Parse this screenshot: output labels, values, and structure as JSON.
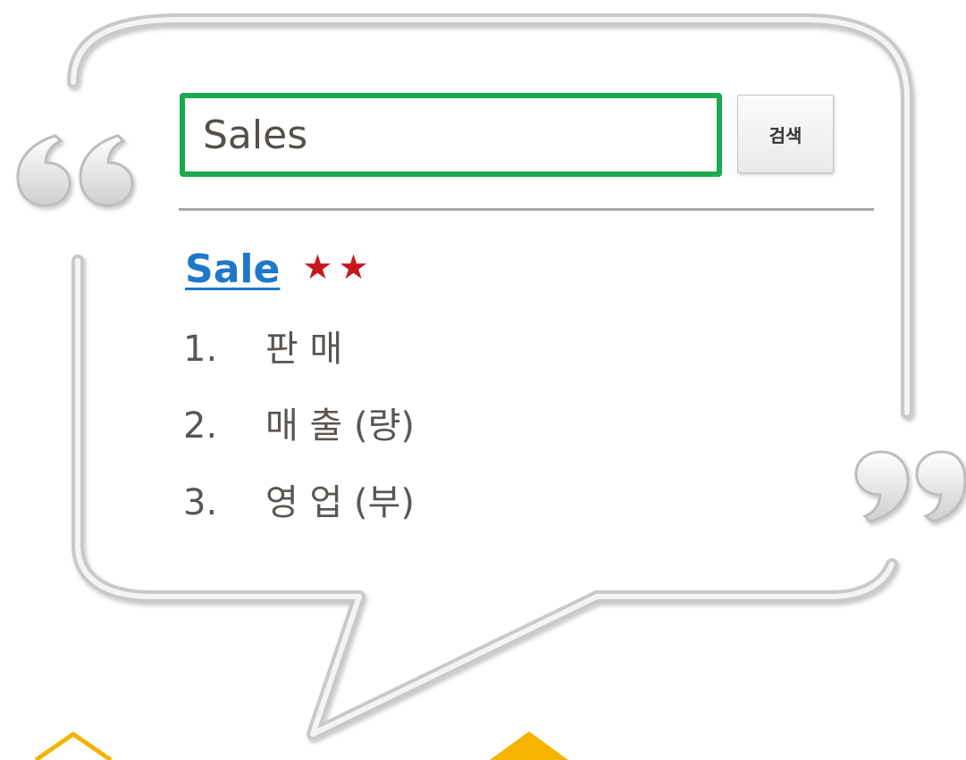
{
  "search": {
    "query": "Sales",
    "button_label": "검색"
  },
  "result": {
    "headword": "Sale",
    "stars": "★★",
    "rating": 2,
    "meanings": [
      {
        "num": "1.",
        "text": "판 매"
      },
      {
        "num": "2.",
        "text": "매 출 (량)"
      },
      {
        "num": "3.",
        "text": "영 업 (부)"
      }
    ]
  },
  "colors": {
    "search_border": "#1aaa4f",
    "link": "#1d78c9",
    "stars": "#c8161d",
    "bubble_outline": "#c9c9c9",
    "bottom_decoration": "#f5b400"
  },
  "icons": {
    "open_quote": "open-quote-icon",
    "close_quote": "close-quote-icon"
  }
}
